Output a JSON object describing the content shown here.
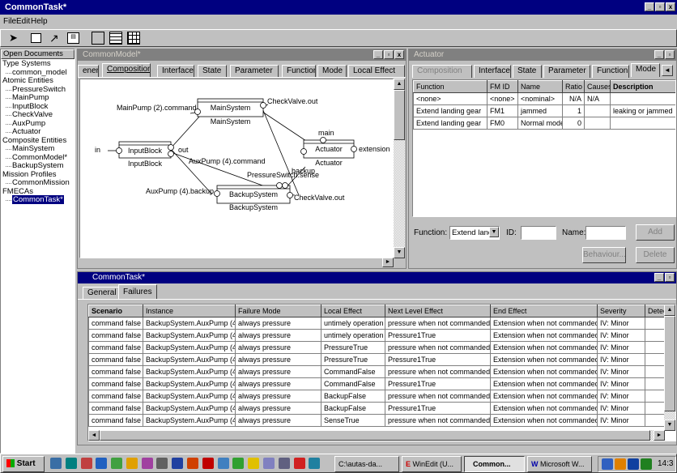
{
  "app": {
    "title": "CommonTask*"
  },
  "menu": {
    "items": [
      "File",
      "Edit",
      "Help"
    ]
  },
  "sidebar": {
    "title": "Open Documents",
    "tree": [
      {
        "label": "Type Systems",
        "level": 0
      },
      {
        "label": "common_model",
        "level": 1
      },
      {
        "label": "Atomic Entities",
        "level": 0
      },
      {
        "label": "PressureSwitch",
        "level": 1
      },
      {
        "label": "MainPump",
        "level": 1
      },
      {
        "label": "InputBlock",
        "level": 1
      },
      {
        "label": "CheckValve",
        "level": 1
      },
      {
        "label": "AuxPump",
        "level": 1
      },
      {
        "label": "Actuator",
        "level": 1
      },
      {
        "label": "Composite Entities",
        "level": 0
      },
      {
        "label": "MainSystem",
        "level": 1
      },
      {
        "label": "CommonModel*",
        "level": 1
      },
      {
        "label": "BackupSystem",
        "level": 1
      },
      {
        "label": "Mission Profiles",
        "level": 0
      },
      {
        "label": "CommonMission",
        "level": 1
      },
      {
        "label": "FMECAs",
        "level": 0
      },
      {
        "label": "CommonTask*",
        "level": 1,
        "selected": true
      }
    ]
  },
  "model_window": {
    "title": "CommonModel*",
    "tabs": [
      "eneral",
      "Composition",
      "Interface",
      "State",
      "Parameter",
      "Function",
      "Mode",
      "Local Effect"
    ],
    "diagram": {
      "blocks": [
        {
          "name": "MainSystem",
          "label": "MainSystem",
          "caption": "MainSystem"
        },
        {
          "name": "InputBlock",
          "label": "InputBlock",
          "caption": "InputBlock"
        },
        {
          "name": "Actuator",
          "label": "Actuator",
          "caption": "Actuator"
        },
        {
          "name": "BackupSystem",
          "label": "BackupSystem",
          "caption": "BackupSystem"
        }
      ],
      "ports": {
        "mainpump_command": "MainPump (2).command",
        "checkvalve_out_top": "CheckValve.out",
        "in": "in",
        "out": "out",
        "main": "main",
        "extension": "extension",
        "backup": "backup",
        "auxpump_command": "AuxPump (4).command",
        "pressureswitch_sense": "PressureSwitch.sense",
        "auxpump_backup": "AuxPump (4).backup",
        "checkvalve_out_bottom": "CheckValve.out"
      }
    }
  },
  "actuator_window": {
    "title": "Actuator",
    "tabs": [
      "Composition",
      "Interface",
      "State",
      "Parameter",
      "Function",
      "Mode"
    ],
    "table": {
      "headers": [
        "Function",
        "FM ID",
        "Name",
        "Ratio",
        "Causes",
        "Description"
      ],
      "rows": [
        [
          "<none>",
          "<none>",
          "<nominal>",
          "N/A",
          "N/A",
          ""
        ],
        [
          "Extend landing gear",
          "FM1",
          "jammed",
          "1",
          "",
          "leaking or jammed"
        ],
        [
          "Extend landing gear",
          "FM0",
          "Normal mode",
          "0",
          "",
          ""
        ]
      ]
    },
    "function_label": "Function:",
    "function_value": "Extend land",
    "id_label": "ID:",
    "name_label": "Name:",
    "add_button": "Add",
    "behaviour_button": "Behaviour...",
    "delete_button": "Delete"
  },
  "task_window": {
    "title": "CommonTask*",
    "tabs": [
      "General",
      "Failures"
    ],
    "table": {
      "headers": [
        "Scenario",
        "Instance",
        "Failure Mode",
        "Local Effect",
        "Next Level Effect",
        "End Effect",
        "Severity",
        "Detec"
      ],
      "rows": [
        [
          "command false",
          "BackupSystem.AuxPump (4)",
          "always pressure",
          "untimely operation",
          "pressure when not commanded",
          "Extension when not commanded",
          "IV: Minor",
          ""
        ],
        [
          "command false",
          "BackupSystem.AuxPump (4)",
          "always pressure",
          "untimely operation",
          "Pressure1True",
          "Extension when not commanded",
          "IV: Minor",
          ""
        ],
        [
          "command false",
          "BackupSystem.AuxPump (4)",
          "always pressure",
          "PressureTrue",
          "pressure when not commanded",
          "Extension when not commanded",
          "IV: Minor",
          ""
        ],
        [
          "command false",
          "BackupSystem.AuxPump (4)",
          "always pressure",
          "PressureTrue",
          "Pressure1True",
          "Extension when not commanded",
          "IV: Minor",
          ""
        ],
        [
          "command false",
          "BackupSystem.AuxPump (4)",
          "always pressure",
          "CommandFalse",
          "pressure when not commanded",
          "Extension when not commanded",
          "IV: Minor",
          ""
        ],
        [
          "command false",
          "BackupSystem.AuxPump (4)",
          "always pressure",
          "CommandFalse",
          "Pressure1True",
          "Extension when not commanded",
          "IV: Minor",
          ""
        ],
        [
          "command false",
          "BackupSystem.AuxPump (4)",
          "always pressure",
          "BackupFalse",
          "pressure when not commanded",
          "Extension when not commanded",
          "IV: Minor",
          ""
        ],
        [
          "command false",
          "BackupSystem.AuxPump (4)",
          "always pressure",
          "BackupFalse",
          "Pressure1True",
          "Extension when not commanded",
          "IV: Minor",
          ""
        ],
        [
          "command false",
          "BackupSystem.AuxPump (4)",
          "always pressure",
          "SenseTrue",
          "pressure when not commanded",
          "Extension when not commanded",
          "IV: Minor",
          ""
        ]
      ]
    }
  },
  "taskbar": {
    "start": "Start",
    "buttons": [
      "C:\\autas-da...",
      "WinEdit (U...",
      "Common...",
      "Microsoft W..."
    ],
    "clock": "14:3"
  }
}
